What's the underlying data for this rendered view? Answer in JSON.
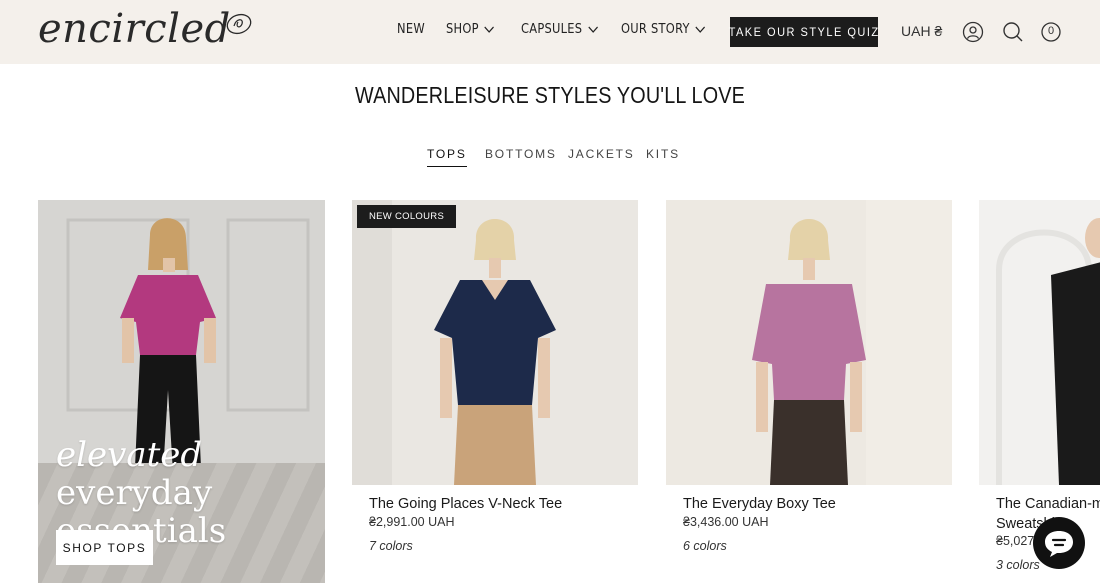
{
  "header": {
    "logo_text": "encircled",
    "nav": [
      {
        "label": "NEW"
      },
      {
        "label": "SHOP"
      },
      {
        "label": "CAPSULES"
      },
      {
        "label": "OUR STORY"
      }
    ],
    "quiz_label": "TAKE OUR STYLE QUIZ",
    "currency": "UAH ₴",
    "cart_count": "0"
  },
  "section": {
    "title": "WANDERLEISURE STYLES YOU'LL LOVE",
    "tabs": [
      {
        "label": "TOPS",
        "active": true
      },
      {
        "label": "BOTTOMS"
      },
      {
        "label": "JACKETS"
      },
      {
        "label": "KITS"
      }
    ]
  },
  "promo": {
    "title_em": "elevated",
    "title_rest": " everyday",
    "title_line2": "essentials",
    "button": "SHOP TOPS"
  },
  "products": [
    {
      "name": "The Going Places V-Neck Tee",
      "price": "₴2,991.00 UAH",
      "colors": "7 colors",
      "badge": "NEW COLOURS",
      "shirt_color": "#1d2a4a",
      "pants_color": "#c9a37a"
    },
    {
      "name": "The Everyday Boxy Tee",
      "price": "₴3,436.00 UAH",
      "colors": "6 colors",
      "shirt_color": "#b7749f",
      "pants_color": "#3a302b"
    },
    {
      "name": "The Canadian-made Sweatshirt",
      "price": "₴5,027",
      "colors": "3 colors",
      "shirt_color": "#1a1a1a"
    }
  ],
  "colors": {
    "header_bg": "#f4f0eb",
    "dark": "#1c1c1c"
  }
}
